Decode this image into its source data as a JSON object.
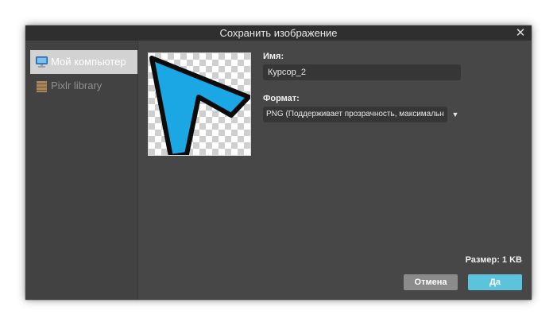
{
  "dialog": {
    "title": "Сохранить изображение",
    "close_glyph": "✕"
  },
  "sidebar": {
    "items": [
      {
        "label": "Мой компьютер",
        "icon": "monitor-icon",
        "active": true
      },
      {
        "label": "Pixlr library",
        "icon": "library-icon",
        "active": false
      }
    ]
  },
  "form": {
    "name_label": "Имя:",
    "name_value": "Курсор_2",
    "format_label": "Формат:",
    "format_value": "PNG (Поддерживает прозрачность, максимальн",
    "format_arrow": "▼",
    "size_text": "Размер: 1 KB"
  },
  "buttons": {
    "cancel": "Отмена",
    "ok": "Да"
  },
  "colors": {
    "dialog_bg": "#474747",
    "titlebar_bg": "#2f2f2f",
    "accent": "#5bc3db",
    "cursor_fill": "#1aa7e4"
  }
}
